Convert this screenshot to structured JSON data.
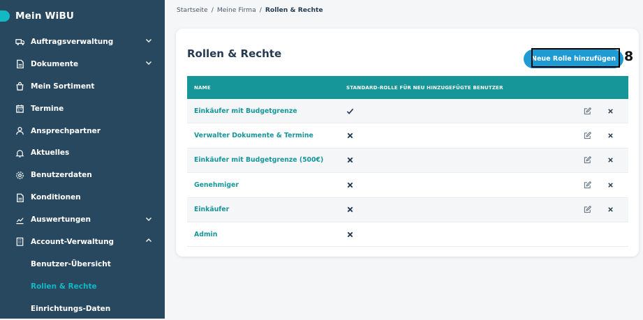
{
  "app": {
    "title": "Mein WiBU",
    "accent": "#13b8c4",
    "sidebar_bg": "#284860"
  },
  "sidebar": {
    "items": [
      {
        "label": "Auftragsverwaltung",
        "icon": "truck-icon",
        "chevron": "down"
      },
      {
        "label": "Dokumente",
        "icon": "document-icon",
        "chevron": "down"
      },
      {
        "label": "Mein Sortiment",
        "icon": "shopping-bag-icon"
      },
      {
        "label": "Termine",
        "icon": "calendar-icon"
      },
      {
        "label": "Ansprechpartner",
        "icon": "person-icon"
      },
      {
        "label": "Aktuelles",
        "icon": "bell-icon"
      },
      {
        "label": "Benutzerdaten",
        "icon": "gear-icon"
      },
      {
        "label": "Konditionen",
        "icon": "document-icon"
      },
      {
        "label": "Auswertungen",
        "icon": "chart-line-icon",
        "chevron": "down"
      },
      {
        "label": "Account-Verwaltung",
        "icon": "building-icon",
        "chevron": "up"
      }
    ],
    "subitems": [
      {
        "label": "Benutzer-Übersicht",
        "active": false
      },
      {
        "label": "Rollen & Rechte",
        "active": true
      },
      {
        "label": "Einrichtungs-Daten",
        "active": false
      }
    ]
  },
  "breadcrumb": {
    "items": [
      "Startseite",
      "Meine Firma"
    ],
    "separator": "/",
    "current": "Rollen & Rechte"
  },
  "page": {
    "title": "Rollen & Rechte",
    "new_role_button": "Neue Rolle hinzufügen",
    "annotation_number": "8"
  },
  "table": {
    "headers": {
      "name": "NAME",
      "standard": "STANDARD-ROLLE FÜR NEU HINZUGEFÜGTE BENUTZER"
    },
    "rows": [
      {
        "name": "Einkäufer mit Budgetgrenze",
        "standard": true,
        "editable": true,
        "deletable": true
      },
      {
        "name": "Verwalter Dokumente & Termine",
        "standard": false,
        "editable": true,
        "deletable": true
      },
      {
        "name": "Einkäufer mit Budgetgrenze (500€)",
        "standard": false,
        "editable": true,
        "deletable": true
      },
      {
        "name": "Genehmiger",
        "standard": false,
        "editable": true,
        "deletable": true
      },
      {
        "name": "Einkäufer",
        "standard": false,
        "editable": true,
        "deletable": true
      },
      {
        "name": "Admin",
        "standard": false,
        "editable": false,
        "deletable": false
      }
    ]
  }
}
